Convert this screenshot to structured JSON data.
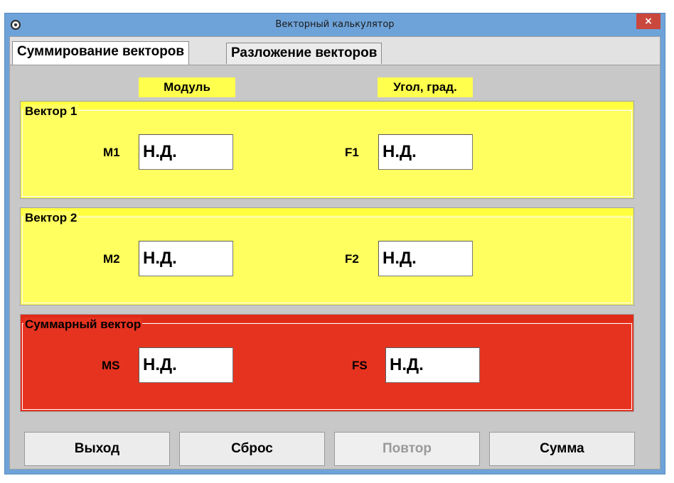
{
  "window": {
    "title": "Векторный калькулятор",
    "close_glyph": "×",
    "icon": "gear-icon"
  },
  "tabs": [
    {
      "label": "Суммирование векторов",
      "active": true
    },
    {
      "label": "Разложение векторов",
      "active": false
    }
  ],
  "headers": {
    "module": "Модуль",
    "angle": "Угол, град."
  },
  "vector1": {
    "title": "Вектор 1",
    "m_label": "M1",
    "m_value": "Н.Д.",
    "f_label": "F1",
    "f_value": "Н.Д."
  },
  "vector2": {
    "title": "Вектор 2",
    "m_label": "M2",
    "m_value": "Н.Д.",
    "f_label": "F2",
    "f_value": "Н.Д."
  },
  "sum": {
    "title": "Суммарный вектор",
    "m_label": "MS",
    "m_value": "Н.Д.",
    "f_label": "FS",
    "f_value": "Н.Д."
  },
  "buttons": {
    "exit": "Выход",
    "reset": "Сброс",
    "repeat": "Повтор",
    "sum": "Сумма"
  },
  "colors": {
    "group": "#ffff60",
    "result": "#e63320",
    "titlebar": "#6ea3d9"
  }
}
